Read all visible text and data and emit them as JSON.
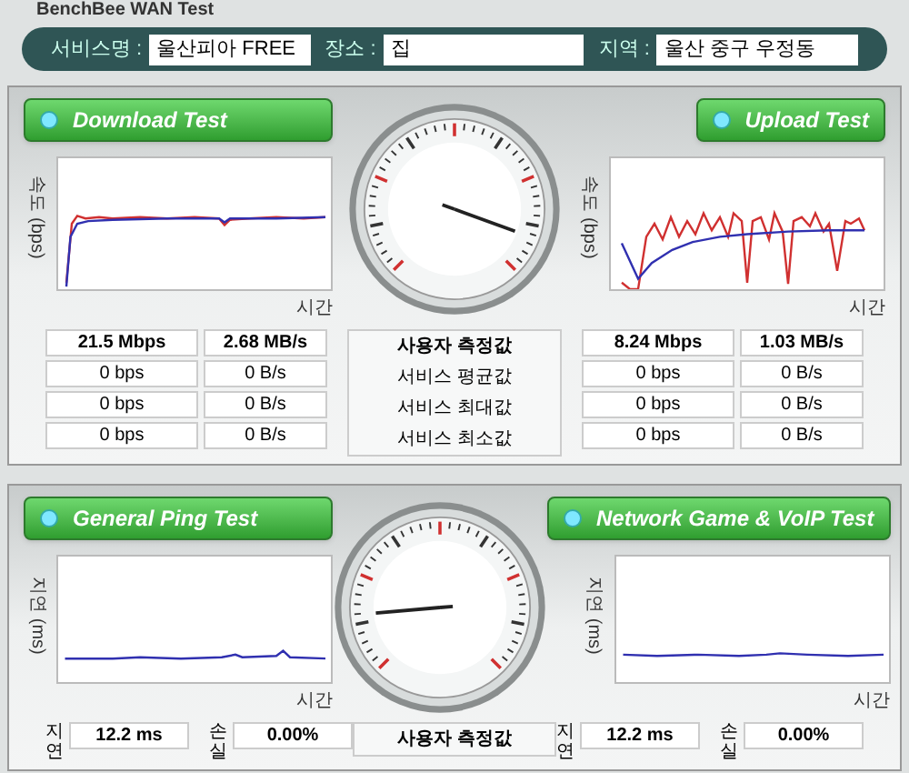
{
  "app_title": "BenchBee WAN Test",
  "info_fields": [
    {
      "label": "서비스명 :",
      "value": "울산피아 FREE"
    },
    {
      "label": "장소 :",
      "value": "집"
    },
    {
      "label": "지역 :",
      "value": "울산 중구 우정동"
    }
  ],
  "speed_panel": {
    "row_labels": [
      "사용자 측정값",
      "서비스 평균값",
      "서비스 최대값",
      "서비스 최소값"
    ],
    "tests": [
      {
        "kind": "download",
        "button": "Download Test",
        "y_axis": "속도 (bps)",
        "x_axis": "시간",
        "rows": [
          [
            "21.5 Mbps",
            "2.68 MB/s"
          ],
          [
            "0 bps",
            "0 B/s"
          ],
          [
            "0 bps",
            "0 B/s"
          ],
          [
            "0 bps",
            "0 B/s"
          ]
        ]
      },
      {
        "kind": "upload",
        "button": "Upload Test",
        "y_axis": "속도 (bps)",
        "x_axis": "시간",
        "rows": [
          [
            "8.24 Mbps",
            "1.03 MB/s"
          ],
          [
            "0 bps",
            "0 B/s"
          ],
          [
            "0 bps",
            "0 B/s"
          ],
          [
            "0 bps",
            "0 B/s"
          ]
        ]
      }
    ]
  },
  "ping_panel": {
    "row_labels": [
      "사용자 측정값"
    ],
    "tests": [
      {
        "kind": "ping",
        "button": "General Ping Test",
        "y_axis": "지연 (ms)",
        "x_axis": "시간",
        "delay_label": "지연",
        "loss_label": "손실",
        "rows": [
          [
            "12.2 ms",
            "0.00%"
          ]
        ]
      },
      {
        "kind": "game",
        "button": "Network Game & VoIP Test",
        "y_axis": "지연 (ms)",
        "x_axis": "시간",
        "delay_label": "지연",
        "loss_label": "손실",
        "rows": [
          [
            "12.2 ms",
            "0.00%"
          ]
        ]
      }
    ]
  }
}
